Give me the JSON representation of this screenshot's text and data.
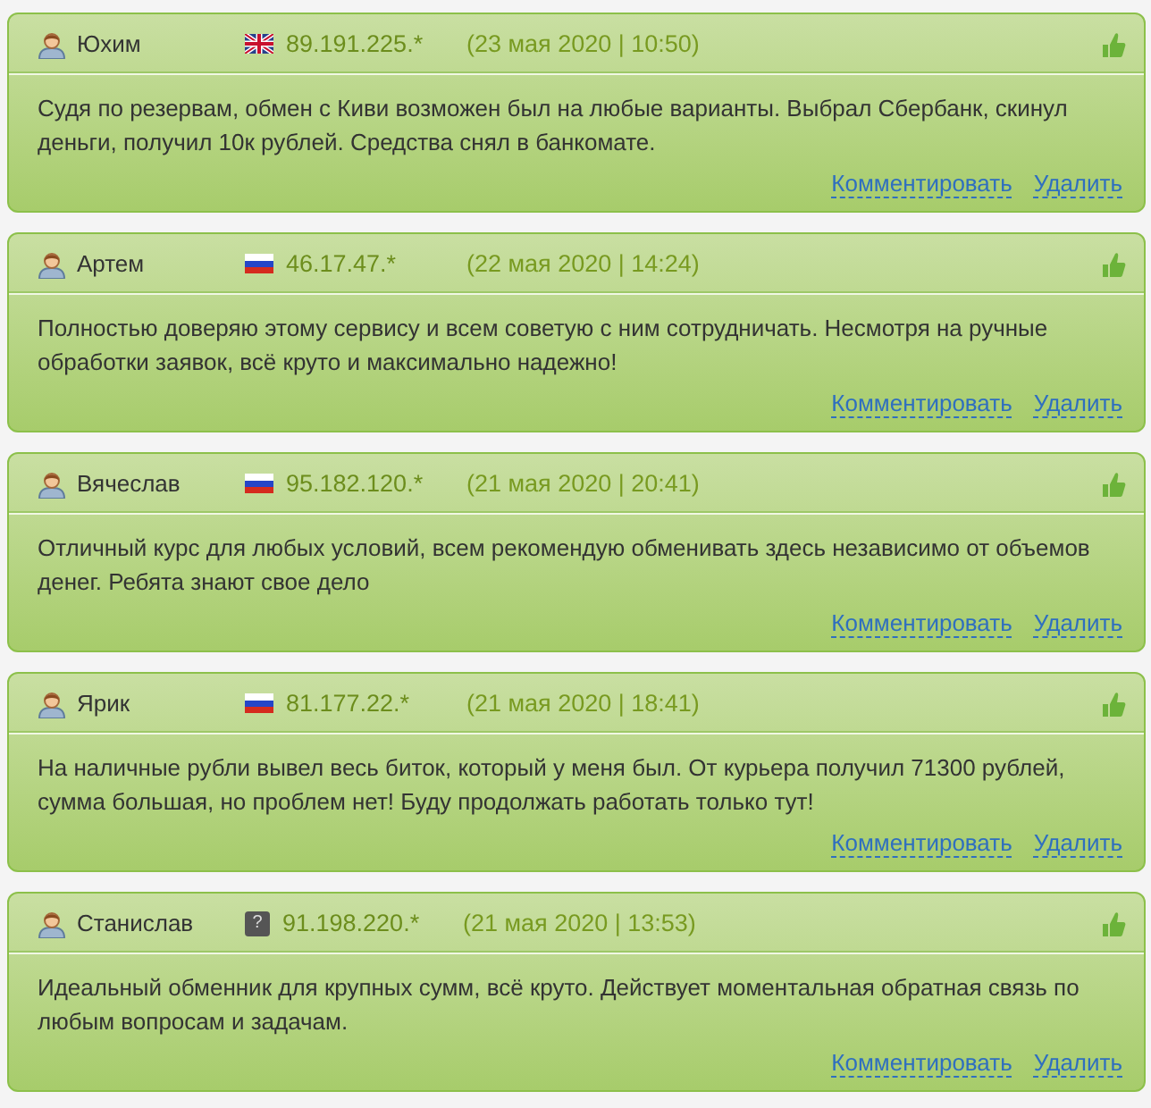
{
  "reviews": [
    {
      "author": "Юхим",
      "flag": {
        "kind": "uk"
      },
      "ip": "89.191.225.*",
      "date": "(23 мая 2020 | 10:50)",
      "text": "Судя по резервам, обмен с Киви возможен был на любые варианты. Выбрал Сбербанк, скинул деньги, получил 10к рублей. Средства снял в банкомате.",
      "actions": [
        "Комментировать",
        "Удалить"
      ]
    },
    {
      "author": "Артем",
      "flag": {
        "kind": "ru"
      },
      "ip": "46.17.47.*",
      "date": "(22 мая 2020 | 14:24)",
      "text": "Полностью доверяю этому сервису и всем советую с ним сотрудничать. Несмотря на ручные обработки заявок, всё круто и максимально надежно!",
      "actions": [
        "Комментировать",
        "Удалить"
      ]
    },
    {
      "author": "Вячеслав",
      "flag": {
        "kind": "ru"
      },
      "ip": "95.182.120.*",
      "date": "(21 мая 2020 | 20:41)",
      "text": "Отличный курс для любых условий, всем рекомендую обменивать здесь независимо от объемов денег. Ребята знают свое дело",
      "actions": [
        "Комментировать",
        "Удалить"
      ]
    },
    {
      "author": "Ярик",
      "flag": {
        "kind": "ru"
      },
      "ip": "81.177.22.*",
      "date": "(21 мая 2020 | 18:41)",
      "text": "На наличные рубли вывел весь биток, который у меня был. От курьера получил 71300 рублей, сумма большая, но проблем нет! Буду продолжать работать только тут!",
      "actions": [
        "Комментировать",
        "Удалить"
      ]
    },
    {
      "author": "Станислав",
      "flag": {
        "kind": "unknown",
        "label": "?"
      },
      "ip": "91.198.220.*",
      "date": "(21 мая 2020 | 13:53)",
      "text": "Идеальный обменник для крупных сумм, всё круто. Действует моментальная обратная связь по любым вопросам и задачам.",
      "actions": [
        "Комментировать",
        "Удалить"
      ]
    }
  ]
}
